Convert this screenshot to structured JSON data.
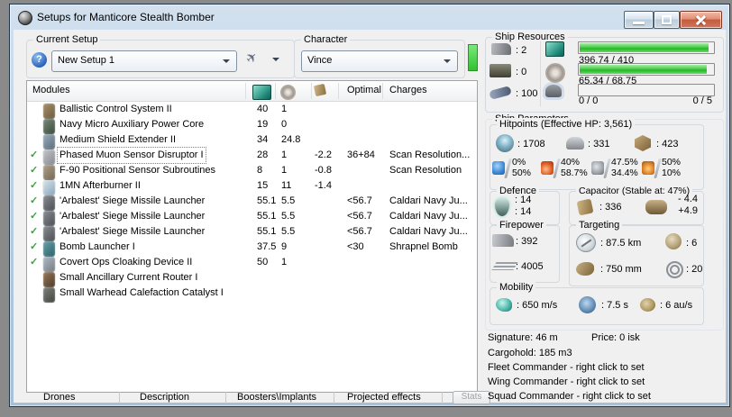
{
  "window": {
    "title": "Setups for Manticore Stealth Bomber"
  },
  "icons": {
    "help": "?",
    "check": "✓",
    "ship_print": "✈"
  },
  "setup": {
    "label": "Current Setup",
    "value": "New Setup 1"
  },
  "character": {
    "label": "Character",
    "value": "Vince"
  },
  "modules": {
    "header": {
      "name": "Modules",
      "optimal": "Optimal",
      "charges": "Charges"
    },
    "rows": [
      {
        "checked": false,
        "selected": false,
        "name": "Ballistic Control System II",
        "cpu": "40",
        "pg": "1",
        "cap": "",
        "optimal": "",
        "charges": "",
        "icon": [
          "#A8906A",
          "#6A5A3E"
        ]
      },
      {
        "checked": false,
        "selected": false,
        "name": "Navy Micro Auxiliary Power Core",
        "cpu": "19",
        "pg": "0",
        "cap": "",
        "optimal": "",
        "charges": "",
        "icon": [
          "#7A8A7A",
          "#3A4A3A"
        ]
      },
      {
        "checked": false,
        "selected": false,
        "name": "Medium Shield Extender II",
        "cpu": "34",
        "pg": "24.8",
        "cap": "",
        "optimal": "",
        "charges": "",
        "icon": [
          "#9AACBC",
          "#5A6C7C"
        ]
      },
      {
        "checked": true,
        "selected": true,
        "name": "Phased Muon Sensor Disruptor I",
        "cpu": "28",
        "pg": "1",
        "cap": "-2.2",
        "optimal": "36+84",
        "charges": "Scan Resolution...",
        "icon": [
          "#C4C8CC",
          "#84888C"
        ]
      },
      {
        "checked": true,
        "selected": false,
        "name": "F-90 Positional Sensor Subroutines",
        "cpu": "8",
        "pg": "1",
        "cap": "-0.8",
        "optimal": "",
        "charges": "Scan Resolution",
        "icon": [
          "#B0A490",
          "#70644E"
        ]
      },
      {
        "checked": true,
        "selected": false,
        "name": "1MN Afterburner II",
        "cpu": "15",
        "pg": "11",
        "cap": "-1.4",
        "optimal": "",
        "charges": "",
        "icon": [
          "#D8E4EC",
          "#88A4B8"
        ]
      },
      {
        "checked": true,
        "selected": false,
        "name": "'Arbalest' Siege Missile Launcher",
        "cpu": "55.1",
        "pg": "5.5",
        "cap": "",
        "optimal": "<56.7",
        "charges": "Caldari Navy Ju...",
        "icon": [
          "#8A8E92",
          "#4A4E52"
        ]
      },
      {
        "checked": true,
        "selected": false,
        "name": "'Arbalest' Siege Missile Launcher",
        "cpu": "55.1",
        "pg": "5.5",
        "cap": "",
        "optimal": "<56.7",
        "charges": "Caldari Navy Ju...",
        "icon": [
          "#8A8E92",
          "#4A4E52"
        ]
      },
      {
        "checked": true,
        "selected": false,
        "name": "'Arbalest' Siege Missile Launcher",
        "cpu": "55.1",
        "pg": "5.5",
        "cap": "",
        "optimal": "<56.7",
        "charges": "Caldari Navy Ju...",
        "icon": [
          "#8A8E92",
          "#4A4E52"
        ]
      },
      {
        "checked": true,
        "selected": false,
        "name": "Bomb Launcher I",
        "cpu": "37.5",
        "pg": "9",
        "cap": "",
        "optimal": "<30",
        "charges": "Shrapnel Bomb",
        "icon": [
          "#6AA0A8",
          "#2A6068"
        ]
      },
      {
        "checked": true,
        "selected": false,
        "name": "Covert Ops Cloaking Device II",
        "cpu": "50",
        "pg": "1",
        "cap": "",
        "optimal": "",
        "charges": "",
        "icon": [
          "#B2BAC4",
          "#727A84"
        ]
      },
      {
        "checked": false,
        "selected": false,
        "name": "Small Ancillary Current Router I",
        "cpu": "",
        "pg": "",
        "cap": "",
        "optimal": "",
        "charges": "",
        "icon": [
          "#9A7A5A",
          "#4A3A2A"
        ]
      },
      {
        "checked": false,
        "selected": false,
        "name": "Small Warhead Calefaction Catalyst I",
        "cpu": "",
        "pg": "",
        "cap": "",
        "optimal": "",
        "charges": "",
        "icon": [
          "#80827E",
          "#40423E"
        ]
      }
    ]
  },
  "tabs": [
    "Drones",
    "Description",
    "Boosters\\Implants",
    "Projected effects"
  ],
  "stats_button": "Stats",
  "ship_resources": {
    "label": "Ship Resources",
    "turrets": ": 2",
    "launchers": ": 0",
    "calibration": ": 100",
    "cpu": {
      "text": "396.74 / 410",
      "pct": 96.8
    },
    "powergrid": {
      "text": "65.34 / 68.75",
      "pct": 95
    },
    "drones": {
      "used": "0 / 0",
      "bandwidth": "0 / 5",
      "pct": 0
    }
  },
  "ship_parameters": {
    "label": "Ship Parameters",
    "hitpoints": {
      "label": "Hitpoints (Effective HP: 3,561)",
      "shield": ": 1708",
      "armor": ": 331",
      "structure": ": 423",
      "resists": [
        {
          "name": "em",
          "top": "0%",
          "bottom": "50%"
        },
        {
          "name": "thermal",
          "top": "40%",
          "bottom": "58.7%"
        },
        {
          "name": "kinetic",
          "top": "47.5%",
          "bottom": "34.4%"
        },
        {
          "name": "explosive",
          "top": "50%",
          "bottom": "10%"
        }
      ]
    },
    "defence": {
      "label": "Defence",
      "line1": ": 14",
      "line2": ": 14"
    },
    "capacitor": {
      "label": "Capacitor (Stable at: 47%)",
      "amount": ": 336",
      "peak": "- 4.4",
      "recharge": "+4.9"
    },
    "firepower": {
      "label": "Firepower",
      "dps": ": 392",
      "volley": ": 4005"
    },
    "targeting": {
      "label": "Targeting",
      "range": ": 87.5 km",
      "sensor_strength": ": 6",
      "scan_resolution": ": 750 mm",
      "max_targets": ": 20"
    },
    "mobility": {
      "label": "Mobility",
      "speed": ": 650 m/s",
      "align_time": ": 7.5 s",
      "warp_speed": ": 6 au/s"
    }
  },
  "footer": {
    "signature": "Signature: 46 m",
    "price": "Price: 0 isk",
    "cargohold": "Cargohold: 185 m3",
    "fleet": "Fleet Commander - right click to set",
    "wing": "Wing Commander - right click to set",
    "squad": "Squad Commander - right click to set"
  },
  "colors": {
    "bar_green": "#25B625",
    "check_green": "#3CA33C",
    "close_red": "#C25C40"
  }
}
